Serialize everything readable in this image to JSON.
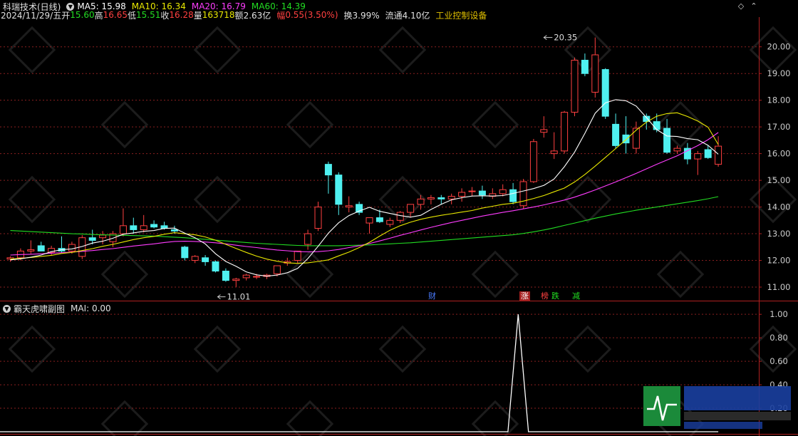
{
  "header": {
    "stock": "科瑞技术(日线)",
    "ma": [
      {
        "label": "MA5: 15.98",
        "color": "#ffffff"
      },
      {
        "label": "MA10: 16.34",
        "color": "#e8e800"
      },
      {
        "label": "MA20: 16.79",
        "color": "#ff3cff"
      },
      {
        "label": "MA60: 14.39",
        "color": "#22dd22"
      }
    ]
  },
  "info": {
    "date": "2024/11/29/五",
    "open_label": "开",
    "open_value": "15.60",
    "high_label": "高",
    "high_value": "16.65",
    "low_label": "低",
    "low_value": "15.51",
    "close_label": "收",
    "close_value": "16.28",
    "volume_label": "量",
    "volume_value": "163718",
    "amount_label": "额",
    "amount_value": "2.63亿",
    "change_label": "幅",
    "change_value": "0.55(3.50%)",
    "turnover": "换3.99%",
    "float_cap": "流通4.10亿",
    "industry": "工业控制设备"
  },
  "event_tags": [
    {
      "label": "财",
      "x": 41
    },
    {
      "label": "涨",
      "x": 50
    },
    {
      "label": "榜",
      "x": 52
    },
    {
      "label": "跌",
      "x": 53
    },
    {
      "label": "减",
      "x": 55
    }
  ],
  "sub": {
    "name": "霸天虎啸副图",
    "indicator": "MAI: 0.00"
  },
  "colors": {
    "up": "#ff4040",
    "down": "#4ff0f0",
    "ma5": "#ffffff",
    "ma10": "#e8e800",
    "ma20": "#ff3cff",
    "ma60": "#22dd22",
    "grid": "#8a1f1f",
    "axis_text": "#cccccc",
    "accent": "#e0c000"
  },
  "chart_data": [
    {
      "type": "candlestick",
      "price_axis": {
        "ticks": [
          11.0,
          12.0,
          13.0,
          14.0,
          15.0,
          16.0,
          17.0,
          18.0,
          19.0,
          20.0
        ],
        "labels": [
          "11.00",
          "12.00",
          "13.00",
          "14.00",
          "15.00",
          "16.00",
          "17.00",
          "18.00",
          "19.00",
          "20.00"
        ],
        "ylim": [
          10.6,
          20.9
        ]
      },
      "annotations": [
        {
          "text": "20.35",
          "x": 52,
          "y": 20.35
        },
        {
          "text": "11.01",
          "x": 20,
          "y": 11.01
        }
      ],
      "grid": true,
      "candles": [
        [
          12.05,
          12.15,
          11.95,
          12.1
        ],
        [
          12.1,
          12.45,
          12.0,
          12.35
        ],
        [
          12.35,
          12.75,
          12.25,
          12.4
        ],
        [
          12.55,
          12.7,
          12.4,
          12.35
        ],
        [
          12.3,
          12.55,
          12.2,
          12.45
        ],
        [
          12.45,
          12.9,
          12.3,
          12.35
        ],
        [
          12.35,
          12.7,
          12.25,
          12.6
        ],
        [
          12.15,
          12.95,
          12.05,
          12.85
        ],
        [
          12.85,
          13.15,
          12.6,
          12.75
        ],
        [
          12.85,
          13.1,
          12.6,
          12.95
        ],
        [
          12.7,
          13.1,
          12.5,
          13.0
        ],
        [
          13.0,
          13.95,
          12.9,
          13.3
        ],
        [
          13.3,
          13.6,
          13.0,
          13.15
        ],
        [
          13.15,
          13.7,
          13.05,
          13.3
        ],
        [
          13.35,
          13.5,
          13.2,
          13.25
        ],
        [
          13.3,
          13.45,
          13.15,
          13.2
        ],
        [
          13.15,
          13.3,
          13.0,
          13.1
        ],
        [
          12.5,
          12.55,
          12.0,
          12.1
        ],
        [
          12.0,
          12.2,
          11.9,
          12.15
        ],
        [
          12.1,
          12.2,
          11.8,
          11.95
        ],
        [
          11.95,
          12.0,
          11.55,
          11.6
        ],
        [
          11.6,
          11.7,
          11.2,
          11.25
        ],
        [
          11.25,
          11.35,
          11.01,
          11.3
        ],
        [
          11.35,
          11.5,
          11.25,
          11.45
        ],
        [
          11.4,
          11.5,
          11.3,
          11.4
        ],
        [
          11.4,
          11.5,
          11.3,
          11.45
        ],
        [
          11.5,
          11.7,
          11.4,
          11.8
        ],
        [
          11.9,
          12.1,
          11.8,
          11.95
        ],
        [
          12.0,
          12.3,
          11.9,
          12.35
        ],
        [
          12.6,
          13.15,
          12.4,
          13.0
        ],
        [
          13.2,
          14.2,
          13.1,
          14.0
        ],
        [
          15.6,
          15.7,
          14.5,
          15.2
        ],
        [
          15.2,
          15.3,
          13.7,
          14.1
        ],
        [
          14.0,
          14.4,
          13.8,
          14.05
        ],
        [
          14.1,
          14.2,
          13.7,
          13.8
        ],
        [
          13.4,
          13.6,
          13.0,
          13.6
        ],
        [
          13.6,
          13.9,
          13.4,
          13.45
        ],
        [
          13.35,
          13.6,
          13.25,
          13.5
        ],
        [
          13.5,
          13.85,
          13.4,
          13.8
        ],
        [
          13.8,
          14.1,
          13.6,
          14.1
        ],
        [
          14.1,
          14.45,
          13.9,
          14.3
        ],
        [
          14.3,
          14.45,
          14.1,
          14.35
        ],
        [
          14.35,
          14.45,
          14.1,
          14.3
        ],
        [
          14.3,
          14.5,
          14.1,
          14.4
        ],
        [
          14.4,
          14.7,
          14.2,
          14.55
        ],
        [
          14.6,
          14.75,
          14.4,
          14.6
        ],
        [
          14.6,
          14.8,
          14.3,
          14.45
        ],
        [
          14.4,
          14.7,
          14.3,
          14.5
        ],
        [
          14.5,
          14.85,
          14.4,
          14.65
        ],
        [
          14.65,
          14.9,
          14.1,
          14.2
        ],
        [
          14.05,
          15.05,
          13.95,
          14.95
        ],
        [
          14.95,
          16.55,
          14.9,
          16.45
        ],
        [
          16.8,
          17.4,
          16.6,
          16.9
        ],
        [
          16.0,
          16.8,
          15.8,
          16.1
        ],
        [
          16.1,
          17.6,
          16.0,
          17.55
        ],
        [
          17.55,
          19.6,
          17.4,
          19.5
        ],
        [
          19.5,
          19.75,
          18.9,
          19.0
        ],
        [
          18.3,
          20.35,
          18.1,
          19.7
        ],
        [
          19.15,
          19.2,
          17.3,
          17.4
        ],
        [
          17.1,
          17.5,
          16.2,
          16.3
        ],
        [
          16.7,
          17.4,
          16.0,
          16.4
        ],
        [
          16.2,
          17.2,
          16.0,
          16.95
        ],
        [
          17.4,
          17.5,
          16.9,
          17.2
        ],
        [
          17.2,
          17.5,
          16.8,
          16.9
        ],
        [
          16.95,
          17.3,
          16.0,
          16.05
        ],
        [
          16.1,
          16.3,
          16.0,
          16.2
        ],
        [
          16.2,
          16.4,
          15.6,
          15.8
        ],
        [
          15.8,
          16.1,
          15.2,
          16.0
        ],
        [
          16.15,
          16.3,
          15.8,
          15.85
        ],
        [
          15.6,
          16.65,
          15.51,
          16.28
        ]
      ],
      "ma5": [
        12.02,
        12.06,
        12.12,
        12.2,
        12.33,
        12.4,
        12.43,
        12.52,
        12.65,
        12.72,
        12.83,
        12.98,
        13.03,
        13.09,
        13.12,
        13.2,
        13.21,
        13.02,
        12.85,
        12.62,
        12.25,
        11.96,
        11.78,
        11.57,
        11.46,
        11.41,
        11.45,
        11.54,
        11.7,
        12.07,
        12.53,
        13.02,
        13.41,
        13.68,
        13.85,
        13.99,
        13.84,
        13.76,
        13.68,
        13.62,
        13.69,
        13.91,
        14.1,
        14.27,
        14.35,
        14.41,
        14.42,
        14.41,
        14.43,
        14.51,
        14.6,
        14.69,
        14.81,
        15.05,
        15.51,
        16.06,
        16.76,
        17.51,
        17.9,
        18.02,
        17.98,
        17.78,
        17.35,
        16.9,
        16.66,
        16.64,
        16.56,
        16.52,
        16.31,
        15.98
      ],
      "ma10": [
        12.05,
        12.08,
        12.11,
        12.15,
        12.19,
        12.26,
        12.3,
        12.37,
        12.44,
        12.53,
        12.6,
        12.69,
        12.78,
        12.85,
        12.9,
        12.98,
        13.04,
        13.0,
        12.96,
        12.88,
        12.76,
        12.6,
        12.45,
        12.3,
        12.16,
        12.05,
        11.97,
        11.91,
        11.89,
        11.91,
        11.96,
        12.02,
        12.17,
        12.31,
        12.48,
        12.68,
        12.91,
        13.13,
        13.3,
        13.43,
        13.54,
        13.62,
        13.69,
        13.75,
        13.81,
        13.87,
        13.96,
        14.03,
        14.1,
        14.14,
        14.22,
        14.32,
        14.43,
        14.57,
        14.71,
        14.94,
        15.22,
        15.53,
        15.86,
        16.19,
        16.52,
        16.88,
        17.18,
        17.4,
        17.5,
        17.53,
        17.39,
        17.22,
        16.99,
        16.34
      ],
      "ma20": [
        12.2,
        12.22,
        12.23,
        12.25,
        12.27,
        12.29,
        12.31,
        12.34,
        12.37,
        12.41,
        12.44,
        12.49,
        12.54,
        12.58,
        12.62,
        12.67,
        12.71,
        12.72,
        12.71,
        12.69,
        12.66,
        12.62,
        12.57,
        12.52,
        12.48,
        12.43,
        12.39,
        12.36,
        12.33,
        12.32,
        12.33,
        12.36,
        12.41,
        12.48,
        12.55,
        12.63,
        12.73,
        12.83,
        12.94,
        13.04,
        13.14,
        13.24,
        13.33,
        13.42,
        13.5,
        13.58,
        13.66,
        13.73,
        13.8,
        13.86,
        13.93,
        14.0,
        14.08,
        14.17,
        14.26,
        14.37,
        14.5,
        14.64,
        14.79,
        14.94,
        15.1,
        15.26,
        15.43,
        15.6,
        15.76,
        15.92,
        16.11,
        16.3,
        16.52,
        16.79
      ],
      "ma60": [
        13.12,
        13.1,
        13.08,
        13.06,
        13.04,
        13.02,
        13.0,
        12.99,
        12.97,
        12.96,
        12.95,
        12.94,
        12.93,
        12.92,
        12.91,
        12.89,
        12.87,
        12.85,
        12.82,
        12.79,
        12.76,
        12.73,
        12.7,
        12.67,
        12.64,
        12.62,
        12.6,
        12.58,
        12.56,
        12.55,
        12.55,
        12.55,
        12.55,
        12.56,
        12.57,
        12.58,
        12.6,
        12.62,
        12.64,
        12.66,
        12.69,
        12.72,
        12.75,
        12.78,
        12.81,
        12.84,
        12.87,
        12.9,
        12.93,
        12.96,
        13.01,
        13.07,
        13.14,
        13.22,
        13.31,
        13.4,
        13.49,
        13.58,
        13.66,
        13.74,
        13.81,
        13.88,
        13.94,
        14.0,
        14.06,
        14.12,
        14.18,
        14.24,
        14.31,
        14.39
      ]
    },
    {
      "type": "line",
      "name": "MAI",
      "y_axis": {
        "ticks": [
          0.2,
          0.4,
          0.6,
          0.8,
          1.0
        ],
        "labels": [
          "0.20",
          "0.40",
          "0.60",
          "0.80",
          "1.00"
        ],
        "ylim": [
          0,
          1.08
        ]
      },
      "grid": true,
      "values": [
        0,
        0,
        0,
        0,
        0,
        0,
        0,
        0,
        0,
        0,
        0,
        0,
        0,
        0,
        0,
        0,
        0,
        0,
        0,
        0,
        0,
        0,
        0,
        0,
        0,
        0,
        0,
        0,
        0,
        0,
        0,
        0,
        0,
        0,
        0,
        0,
        0,
        0,
        0,
        0,
        0,
        0,
        0,
        0,
        0,
        0,
        0,
        0,
        0,
        0,
        0,
        0,
        0,
        0,
        0,
        0,
        0,
        0,
        0,
        0,
        0,
        0,
        0,
        0,
        0,
        0,
        0,
        0,
        0,
        0
      ],
      "spike": {
        "x_start": 48.5,
        "x_peak": 49.5,
        "x_end": 50.5,
        "value": 1.0
      }
    }
  ]
}
